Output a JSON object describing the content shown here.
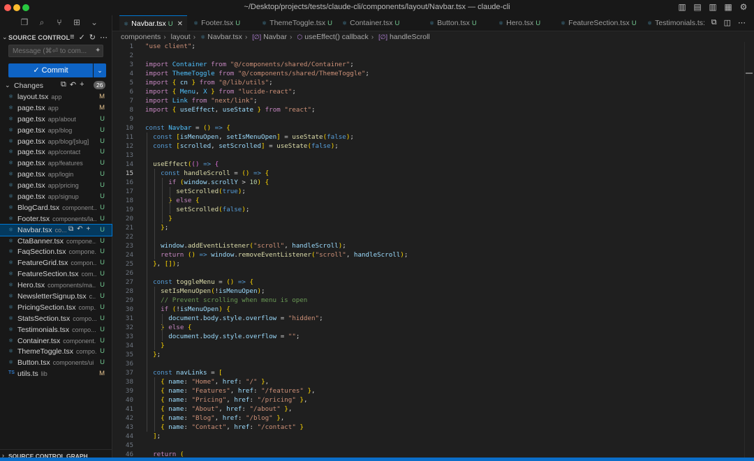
{
  "window": {
    "title": "~/Desktop/projects/tests/claude-cli/components/layout/Navbar.tsx — claude-cli",
    "traffic_colors": {
      "close": "#ff5f57",
      "minimize": "#febc2e",
      "maximize": "#28c840"
    }
  },
  "titlebar_icons": [
    "toggle-primary-sidebar-icon",
    "toggle-panel-icon",
    "toggle-secondary-sidebar-icon",
    "customize-layout-icon",
    "settings-gear-icon"
  ],
  "activity_icons": [
    "explorer-icon",
    "search-icon",
    "source-control-icon",
    "extensions-icon",
    "chevron-down-icon"
  ],
  "scm": {
    "header": "SOURCE CONTROL",
    "message_placeholder": "Message (⌘⏎ to com...",
    "commit_label": "✓ Commit",
    "changes_label": "Changes",
    "changes_count": "26",
    "graph_label": "SOURCE CONTROL GRAPH",
    "files": [
      {
        "name": "layout.tsx",
        "path": "app",
        "status": "M",
        "icon": "react"
      },
      {
        "name": "page.tsx",
        "path": "app",
        "status": "M",
        "icon": "react"
      },
      {
        "name": "page.tsx",
        "path": "app/about",
        "status": "U",
        "icon": "react"
      },
      {
        "name": "page.tsx",
        "path": "app/blog",
        "status": "U",
        "icon": "react"
      },
      {
        "name": "page.tsx",
        "path": "app/blog/[slug]",
        "status": "U",
        "icon": "react"
      },
      {
        "name": "page.tsx",
        "path": "app/contact",
        "status": "U",
        "icon": "react"
      },
      {
        "name": "page.tsx",
        "path": "app/features",
        "status": "U",
        "icon": "react"
      },
      {
        "name": "page.tsx",
        "path": "app/login",
        "status": "U",
        "icon": "react"
      },
      {
        "name": "page.tsx",
        "path": "app/pricing",
        "status": "U",
        "icon": "react"
      },
      {
        "name": "page.tsx",
        "path": "app/signup",
        "status": "U",
        "icon": "react"
      },
      {
        "name": "BlogCard.tsx",
        "path": "component...",
        "status": "U",
        "icon": "react"
      },
      {
        "name": "Footer.tsx",
        "path": "components/la...",
        "status": "U",
        "icon": "react"
      },
      {
        "name": "Navbar.tsx",
        "path": "co...",
        "status": "U",
        "icon": "react",
        "selected": true
      },
      {
        "name": "CtaBanner.tsx",
        "path": "compone...",
        "status": "U",
        "icon": "react"
      },
      {
        "name": "FaqSection.tsx",
        "path": "compone...",
        "status": "U",
        "icon": "react"
      },
      {
        "name": "FeatureGrid.tsx",
        "path": "compon...",
        "status": "U",
        "icon": "react"
      },
      {
        "name": "FeatureSection.tsx",
        "path": "com...",
        "status": "U",
        "icon": "react"
      },
      {
        "name": "Hero.tsx",
        "path": "components/ma...",
        "status": "U",
        "icon": "react"
      },
      {
        "name": "NewsletterSignup.tsx",
        "path": "c...",
        "status": "U",
        "icon": "react"
      },
      {
        "name": "PricingSection.tsx",
        "path": "comp...",
        "status": "U",
        "icon": "react"
      },
      {
        "name": "StatsSection.tsx",
        "path": "compo...",
        "status": "U",
        "icon": "react"
      },
      {
        "name": "Testimonials.tsx",
        "path": "compo...",
        "status": "U",
        "icon": "react"
      },
      {
        "name": "Container.tsx",
        "path": "component...",
        "status": "U",
        "icon": "react"
      },
      {
        "name": "ThemeToggle.tsx",
        "path": "compo...",
        "status": "U",
        "icon": "react"
      },
      {
        "name": "Button.tsx",
        "path": "components/ui",
        "status": "U",
        "icon": "react"
      },
      {
        "name": "utils.ts",
        "path": "lib",
        "status": "M",
        "icon": "ts"
      }
    ]
  },
  "tabs": [
    {
      "label": "Navbar.tsx",
      "status": "U",
      "active": true
    },
    {
      "label": "Footer.tsx",
      "status": "U"
    },
    {
      "label": "ThemeToggle.tsx",
      "status": "U"
    },
    {
      "label": "Container.tsx",
      "status": "U"
    },
    {
      "label": "Button.tsx",
      "status": "U"
    },
    {
      "label": "Hero.tsx",
      "status": "U"
    },
    {
      "label": "FeatureSection.tsx",
      "status": "U"
    },
    {
      "label": "Testimonials.ts:",
      "status": ""
    }
  ],
  "breadcrumb": [
    "components",
    "layout",
    "Navbar.tsx",
    "Navbar",
    "useEffect() callback",
    "handleScroll"
  ],
  "editor": {
    "current_line": 15,
    "lines": [
      {
        "n": 1,
        "t": "\"use client\";"
      },
      {
        "n": 2,
        "t": ""
      },
      {
        "n": 3,
        "t": "import Container from \"@/components/shared/Container\";"
      },
      {
        "n": 4,
        "t": "import ThemeToggle from \"@/components/shared/ThemeToggle\";"
      },
      {
        "n": 5,
        "t": "import { cn } from \"@/lib/utils\";"
      },
      {
        "n": 6,
        "t": "import { Menu, X } from \"lucide-react\";"
      },
      {
        "n": 7,
        "t": "import Link from \"next/link\";"
      },
      {
        "n": 8,
        "t": "import { useEffect, useState } from \"react\";"
      },
      {
        "n": 9,
        "t": ""
      },
      {
        "n": 10,
        "t": "const Navbar = () => {"
      },
      {
        "n": 11,
        "t": "  const [isMenuOpen, setIsMenuOpen] = useState(false);"
      },
      {
        "n": 12,
        "t": "  const [scrolled, setScrolled] = useState(false);"
      },
      {
        "n": 13,
        "t": ""
      },
      {
        "n": 14,
        "t": "  useEffect(() => {"
      },
      {
        "n": 15,
        "t": "    const handleScroll = () => {"
      },
      {
        "n": 16,
        "t": "      if (window.scrollY > 10) {"
      },
      {
        "n": 17,
        "t": "        setScrolled(true);"
      },
      {
        "n": 18,
        "t": "      } else {"
      },
      {
        "n": 19,
        "t": "        setScrolled(false);"
      },
      {
        "n": 20,
        "t": "      }"
      },
      {
        "n": 21,
        "t": "    };"
      },
      {
        "n": 22,
        "t": ""
      },
      {
        "n": 23,
        "t": "    window.addEventListener(\"scroll\", handleScroll);"
      },
      {
        "n": 24,
        "t": "    return () => window.removeEventListener(\"scroll\", handleScroll);"
      },
      {
        "n": 25,
        "t": "  }, []);"
      },
      {
        "n": 26,
        "t": ""
      },
      {
        "n": 27,
        "t": "  const toggleMenu = () => {"
      },
      {
        "n": 28,
        "t": "    setIsMenuOpen(!isMenuOpen);"
      },
      {
        "n": 29,
        "t": "    // Prevent scrolling when menu is open"
      },
      {
        "n": 30,
        "t": "    if (!isMenuOpen) {"
      },
      {
        "n": 31,
        "t": "      document.body.style.overflow = \"hidden\";"
      },
      {
        "n": 32,
        "t": "    } else {"
      },
      {
        "n": 33,
        "t": "      document.body.style.overflow = \"\";"
      },
      {
        "n": 34,
        "t": "    }"
      },
      {
        "n": 35,
        "t": "  };"
      },
      {
        "n": 36,
        "t": ""
      },
      {
        "n": 37,
        "t": "  const navLinks = ["
      },
      {
        "n": 38,
        "t": "    { name: \"Home\", href: \"/\" },"
      },
      {
        "n": 39,
        "t": "    { name: \"Features\", href: \"/features\" },"
      },
      {
        "n": 40,
        "t": "    { name: \"Pricing\", href: \"/pricing\" },"
      },
      {
        "n": 41,
        "t": "    { name: \"About\", href: \"/about\" },"
      },
      {
        "n": 42,
        "t": "    { name: \"Blog\", href: \"/blog\" },"
      },
      {
        "n": 43,
        "t": "    { name: \"Contact\", href: \"/contact\" }"
      },
      {
        "n": 44,
        "t": "  ];"
      },
      {
        "n": 45,
        "t": ""
      },
      {
        "n": 46,
        "t": "  return ("
      }
    ]
  }
}
